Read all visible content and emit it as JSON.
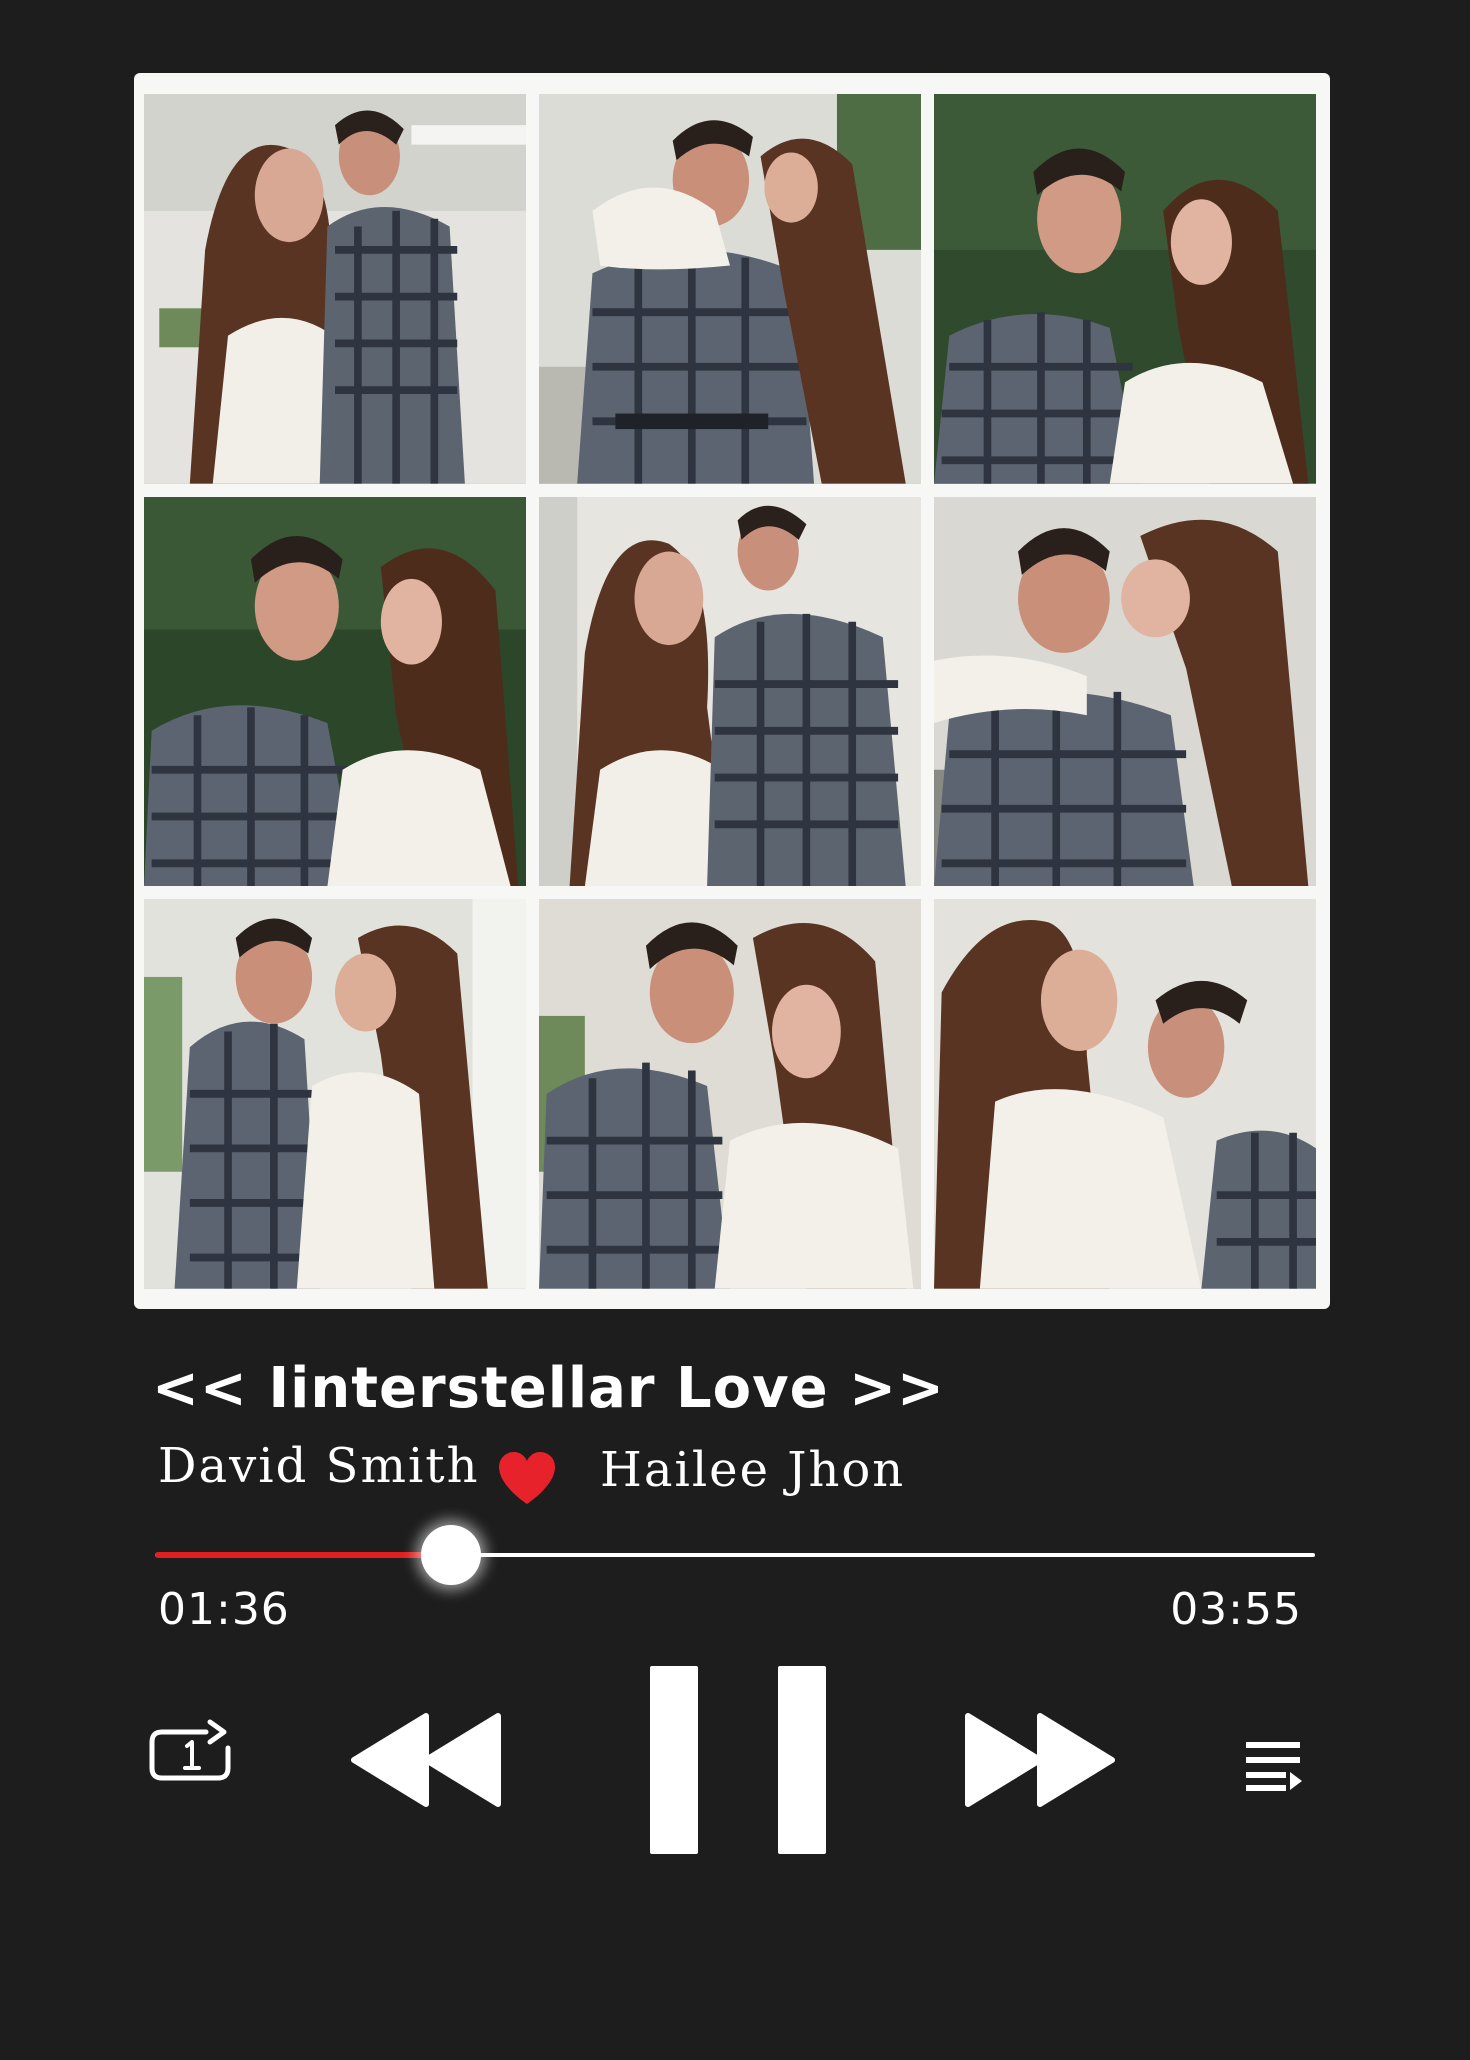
{
  "player": {
    "song_title": "<< Iinterstellar Love >>",
    "artist_left": "David Smith",
    "artist_right": "Hailee Jhon",
    "time_current": "01:36",
    "time_total": "03:55",
    "progress_fraction": 0.255
  },
  "colors": {
    "background": "#1d1d1d",
    "collage_frame": "#f7f7f6",
    "accent": "#e02020",
    "foreground": "#ffffff"
  },
  "collage": {
    "photo_count": 9
  },
  "icons": {
    "heart": "heart-icon",
    "repeat": "repeat-one-icon",
    "previous": "rewind-icon",
    "pause": "pause-icon",
    "next": "fast-forward-icon",
    "queue": "playlist-icon"
  }
}
